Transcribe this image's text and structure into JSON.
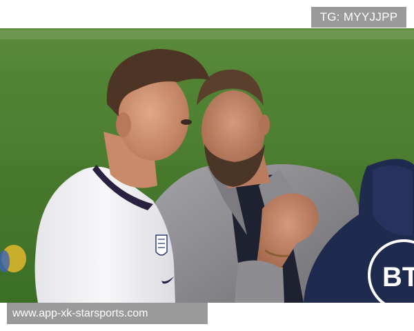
{
  "watermark_top": {
    "text": "TG: MYYJJPP"
  },
  "watermark_bottom": {
    "text": "www.app-xk-starsports.com"
  },
  "photo": {
    "jacket_logo": "BT",
    "colors": {
      "pitch": "#3f7a2e",
      "shirt": "#f1f1f3",
      "blazer": "#8e8d92",
      "jacket": "#1f2a4f",
      "skin": "#c98e6e"
    }
  }
}
